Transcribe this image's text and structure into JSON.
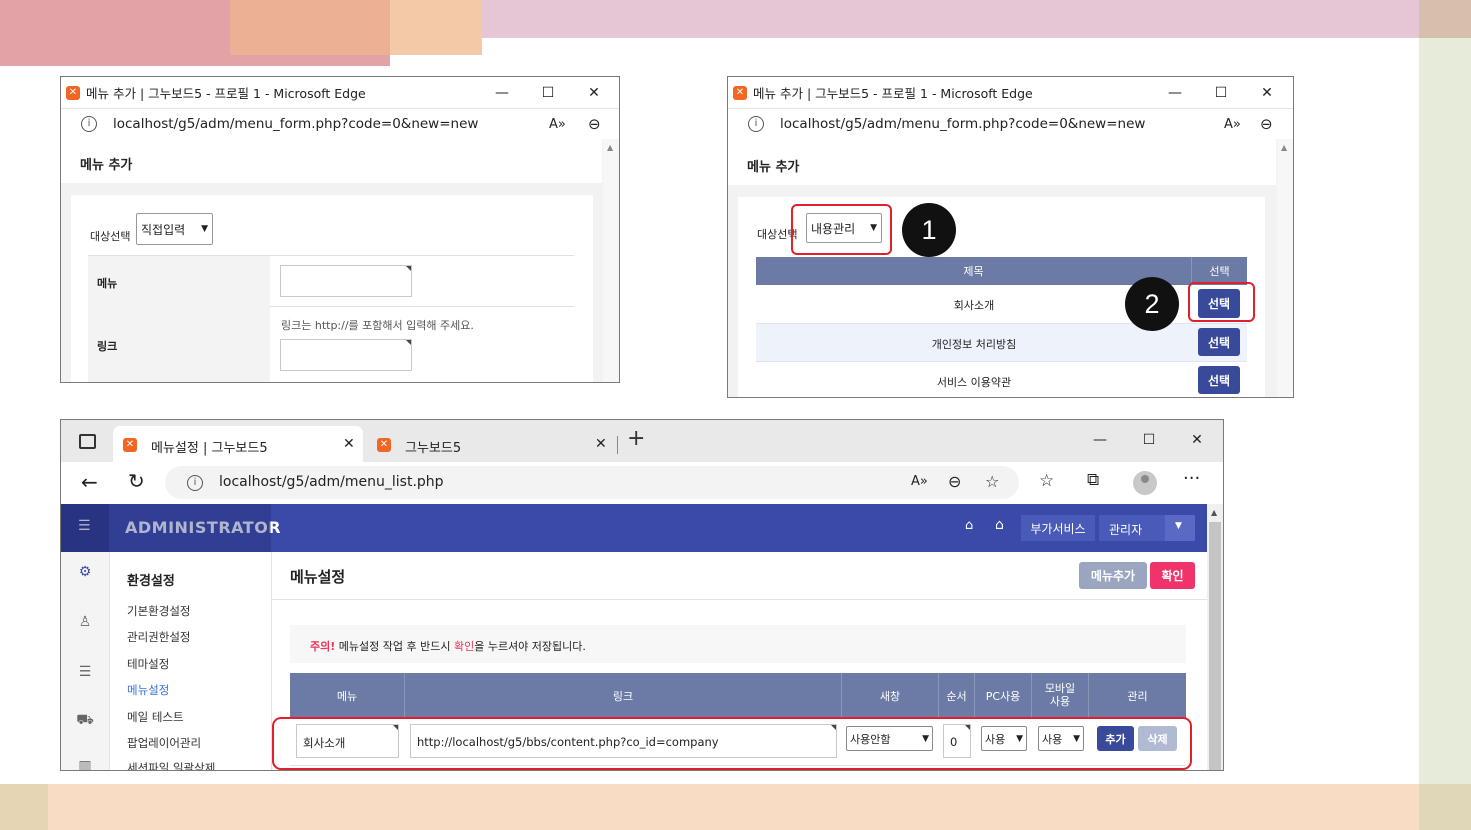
{
  "popup_left": {
    "window_title": "메뉴 추가 | 그누보드5 - 프로필 1 - Microsoft Edge",
    "url": "localhost/g5/adm/menu_form.php?code=0&new=new",
    "heading": "메뉴 추가",
    "target_label": "대상선택",
    "target_value": "직접입력",
    "menu_label": "메뉴",
    "link_label": "링크",
    "link_help": "링크는 http://를 포함해서 입력해 주세요."
  },
  "popup_right": {
    "window_title": "메뉴 추가 | 그누보드5 - 프로필 1 - Microsoft Edge",
    "url": "localhost/g5/adm/menu_form.php?code=0&new=new",
    "heading": "메뉴 추가",
    "target_label": "대상선택",
    "target_value": "내용관리",
    "col_title": "제목",
    "col_select": "선택",
    "rows": [
      {
        "title": "회사소개",
        "button": "선택"
      },
      {
        "title": "개인정보 처리방침",
        "button": "선택"
      },
      {
        "title": "서비스 이용약관",
        "button": "선택"
      }
    ],
    "step1": "1",
    "step2": "2"
  },
  "browser": {
    "tabs": [
      {
        "label": "메뉴설정 | 그누보드5"
      },
      {
        "label": "그누보드5"
      }
    ],
    "new_tab": "+",
    "url": "localhost/g5/adm/menu_list.php",
    "admin": {
      "brand": "ADMINISTRATOR",
      "addon_button": "부가서비스",
      "user_button": "관리자"
    },
    "sidebar": {
      "section_title": "환경설정",
      "items": [
        "기본환경설정",
        "관리권한설정",
        "테마설정",
        "메뉴설정",
        "메일 테스트",
        "팝업레이어관리",
        "세션파일 일괄삭제"
      ]
    },
    "page": {
      "title": "메뉴설정",
      "add_menu_button": "메뉴추가",
      "confirm_button": "확인",
      "notice_prefix": "주의!",
      "notice_mid": " 메뉴설정 작업 후 반드시 ",
      "notice_highlight": "확인",
      "notice_suffix": "을 누르셔야 저장됩니다."
    },
    "table": {
      "headers": [
        "메뉴",
        "링크",
        "새창",
        "순서",
        "PC사용",
        "모바일사용",
        "관리"
      ],
      "row": {
        "menu": "회사소개",
        "link": "http://localhost/g5/bbs/content.php?co_id=company",
        "new_window": "사용안함",
        "order": "0",
        "pc_use": "사용",
        "mobile_use": "사용",
        "add_button": "추가",
        "delete_button": "삭제"
      }
    }
  },
  "colors": {
    "admin_header": "#3b4aa8",
    "admin_header_dark": "#2e3a8c",
    "pink_button": "#f0336a",
    "gray_button": "#9aa6c0",
    "table_header": "#6b7ba5",
    "annotation_red": "#e0202c"
  }
}
